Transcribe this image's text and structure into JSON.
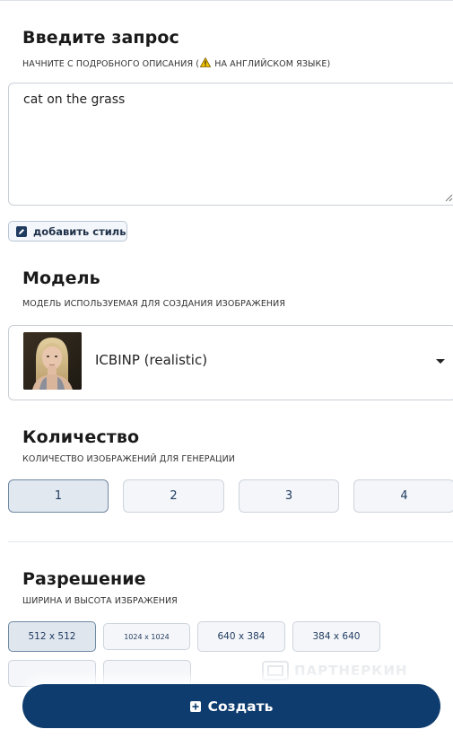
{
  "prompt_section": {
    "title": "Введите запрос",
    "subtitle_before": "НАЧНИТЕ С ПОДРОБНОГО ОПИСАНИЯ (",
    "subtitle_after": " НА АНГЛИЙСКОМ ЯЗЫКЕ)",
    "value": "cat on the grass",
    "add_style_label": "добавить стиль"
  },
  "model_section": {
    "title": "Модель",
    "subtitle": "МОДЕЛЬ ИСПОЛЬЗУЕМАЯ ДЛЯ СОЗДАНИЯ ИЗОБРАЖЕНИЯ",
    "selected": "ICBINP (realistic)"
  },
  "quantity_section": {
    "title": "Количество",
    "subtitle": "КОЛИЧЕСТВО ИЗОБРАЖЕНИЙ ДЛЯ ГЕНЕРАЦИИ",
    "options": [
      "1",
      "2",
      "3",
      "4"
    ],
    "selected": "1"
  },
  "resolution_section": {
    "title": "Разрешение",
    "subtitle": "ШИРИНА И ВЫСОТА ИЗБРАЖЕНИЯ",
    "options": [
      "512 x 512",
      "1024 x 1024",
      "640 x 384",
      "384 x 640"
    ],
    "selected": "512 x 512"
  },
  "watermark": "ПАРТНЕРКИН",
  "create_label": "Создать",
  "colors": {
    "primary": "#0e3c6e",
    "warning": "#f2c200"
  }
}
